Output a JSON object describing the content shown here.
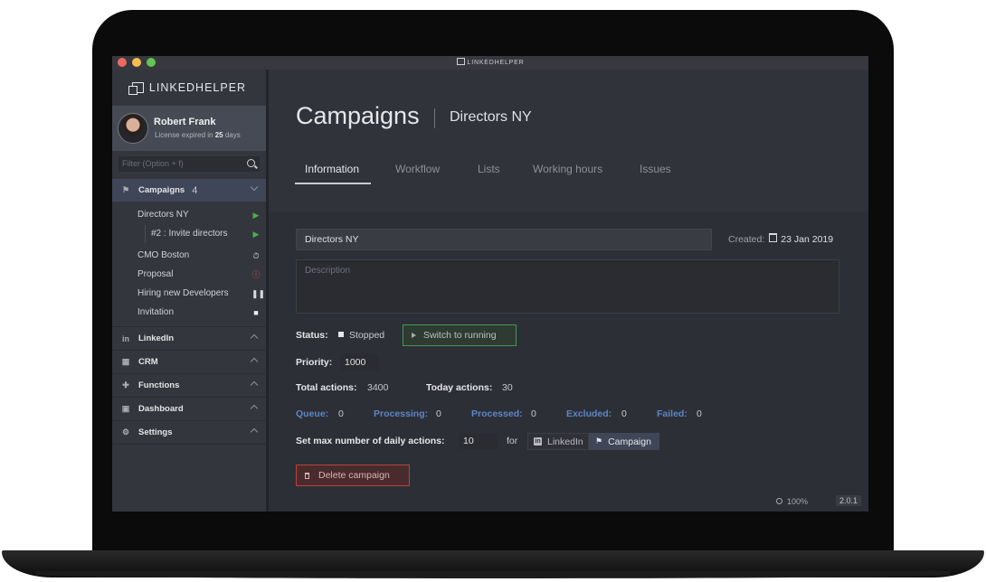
{
  "window": {
    "title": "LINKEDHELPER"
  },
  "sidebar": {
    "logo": "LINKEDHELPER",
    "profile": {
      "name": "Robert Frank",
      "license_prefix": "License expired in",
      "license_days": "25",
      "license_suffix": "days"
    },
    "filter_placeholder": "Filter (Option + f)",
    "campaigns": {
      "label": "Campaigns",
      "count": "4",
      "items": [
        {
          "label": "Directors NY",
          "state": "running"
        },
        {
          "label": "#2 : Invite directors",
          "state": "running"
        },
        {
          "label": "CMO Boston",
          "state": "scheduled"
        },
        {
          "label": "Proposal",
          "state": "error"
        },
        {
          "label": "Hiring new Developers",
          "state": "paused"
        },
        {
          "label": "Invitation",
          "state": "stopped"
        }
      ]
    },
    "sections": [
      {
        "label": "LinkedIn",
        "icon": "linkedin-icon"
      },
      {
        "label": "CRM",
        "icon": "grid-icon"
      },
      {
        "label": "Functions",
        "icon": "puzzle-icon"
      },
      {
        "label": "Dashboard",
        "icon": "dashboard-icon"
      },
      {
        "label": "Settings",
        "icon": "gear-icon"
      }
    ]
  },
  "main": {
    "title": "Campaigns",
    "subtitle": "Directors NY",
    "tabs": [
      "Information",
      "Workflow",
      "Lists",
      "Working hours",
      "Issues"
    ],
    "active_tab": "Information",
    "form": {
      "name_value": "Directors NY",
      "created_label": "Created:",
      "created_date": "23 Jan 2019",
      "description_placeholder": "Description",
      "status_label": "Status:",
      "status_value": "Stopped",
      "switch_button": "Switch to running",
      "priority_label": "Priority:",
      "priority_value": "1000",
      "total_actions_label": "Total actions:",
      "total_actions_value": "3400",
      "today_actions_label": "Today actions:",
      "today_actions_value": "30",
      "queue": [
        {
          "label": "Queue:",
          "value": "0"
        },
        {
          "label": "Processing:",
          "value": "0"
        },
        {
          "label": "Processed:",
          "value": "0"
        },
        {
          "label": "Excluded:",
          "value": "0"
        },
        {
          "label": "Failed:",
          "value": "0"
        }
      ],
      "daily_label": "Set max number of daily actions:",
      "daily_value": "10",
      "for_label": "for",
      "toggle_linkedin": "LinkedIn",
      "toggle_campaign": "Campaign",
      "delete_button": "Delete campaign"
    },
    "footer": {
      "zoom": "100%",
      "version": "2.0.1"
    }
  },
  "colors": {
    "accent_blue": "#5b86c8",
    "run_green": "#3f9a53",
    "delete_red": "#b9423d",
    "sidebar_bg": "#34363d",
    "main_bg": "#2d2f36"
  }
}
